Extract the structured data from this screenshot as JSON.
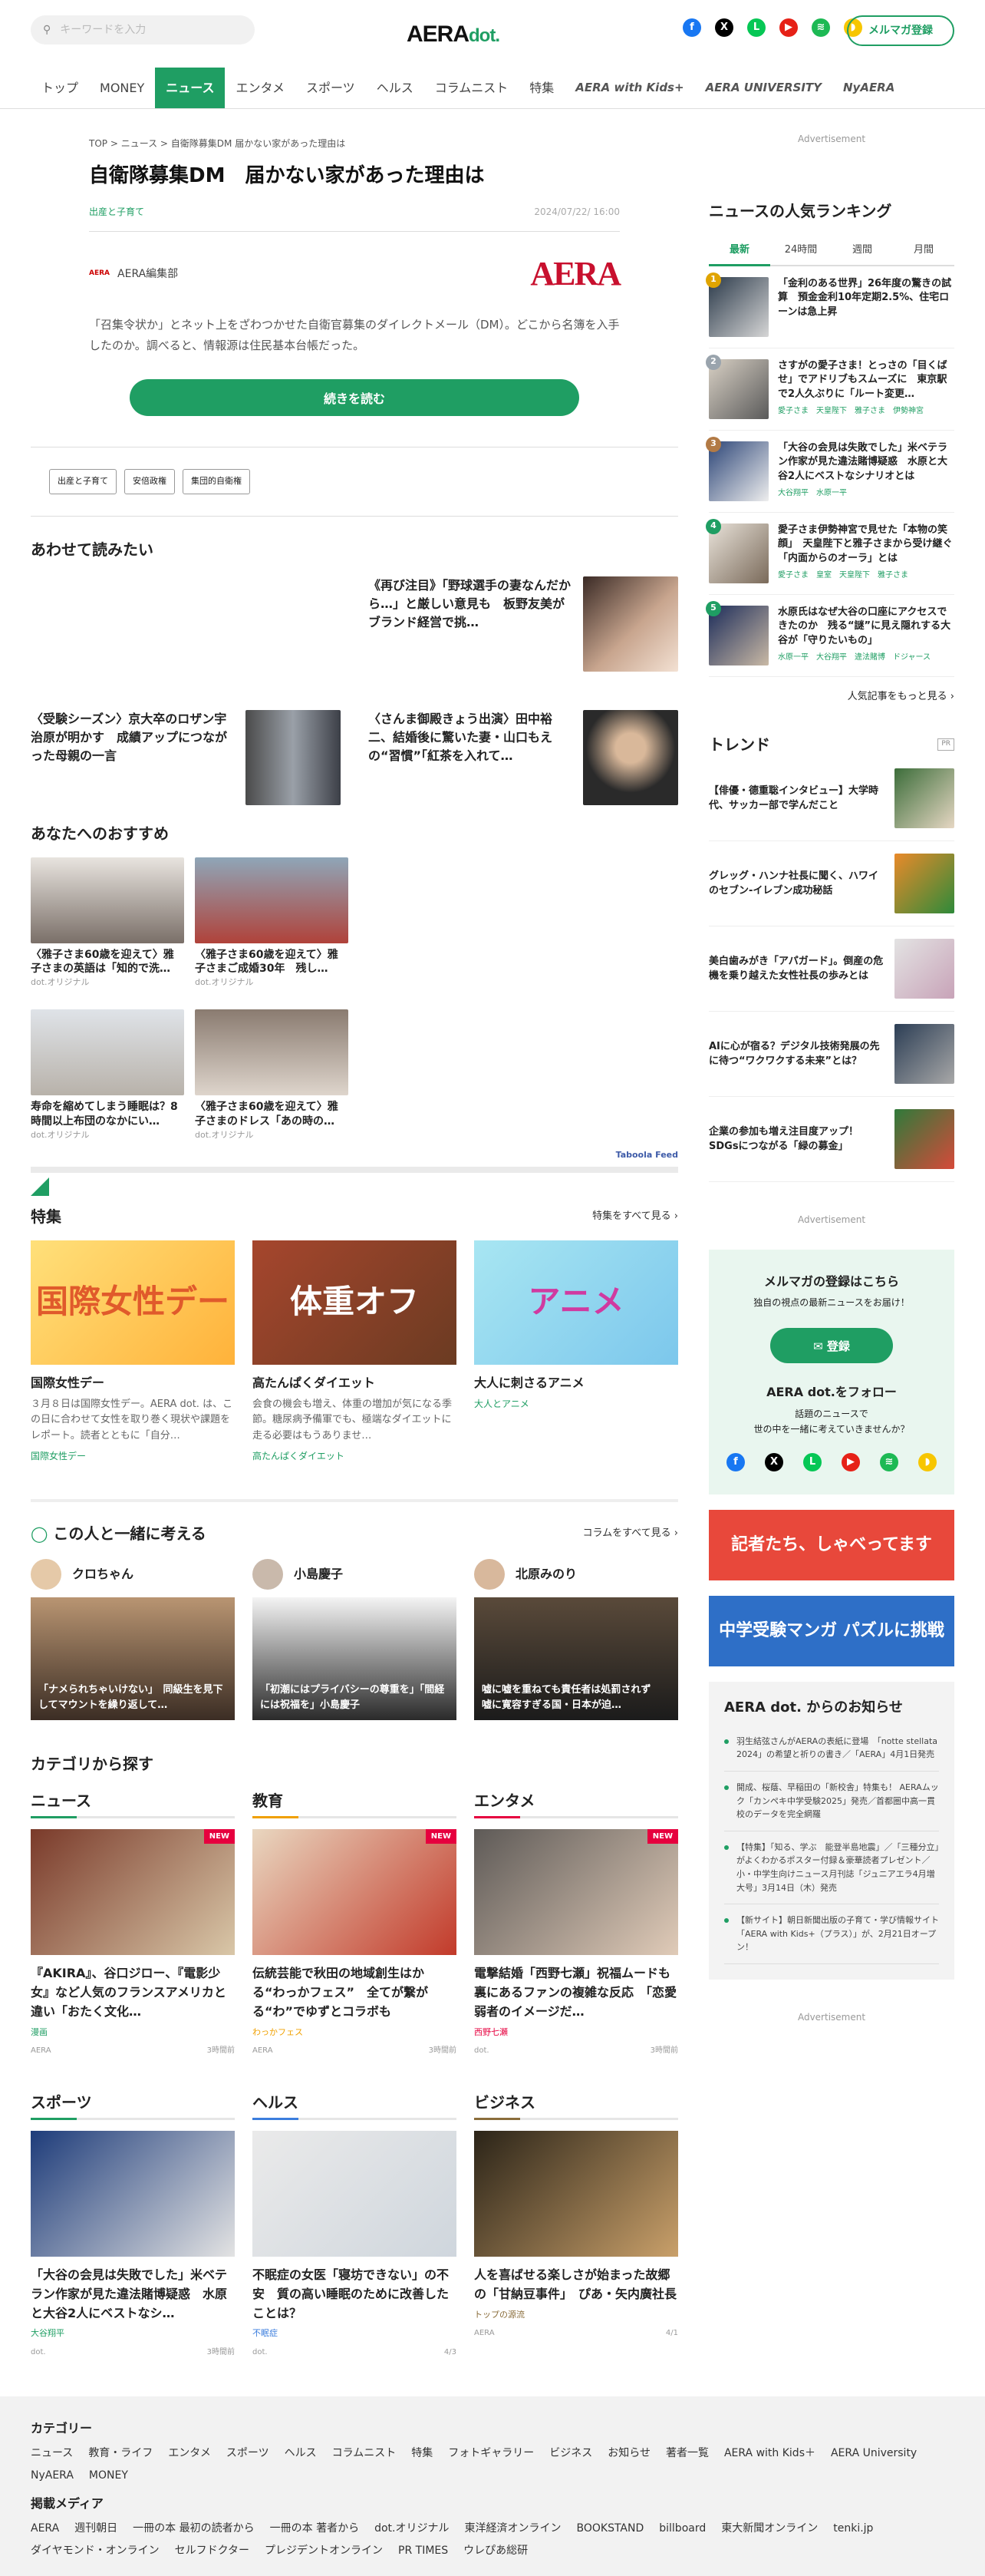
{
  "header": {
    "search_placeholder": "キーワードを入力",
    "logo_main": "AERA",
    "logo_sub": "dot.",
    "mail_button": "メルマガ登録",
    "social": [
      {
        "name": "facebook-icon",
        "glyph": "f",
        "color": "#1877f2"
      },
      {
        "name": "x-icon",
        "glyph": "X",
        "color": "#000000"
      },
      {
        "name": "line-icon",
        "glyph": "L",
        "color": "#06c755"
      },
      {
        "name": "youtube-icon",
        "glyph": "▶",
        "color": "#e62117"
      },
      {
        "name": "spotify-icon",
        "glyph": "≋",
        "color": "#1db954"
      },
      {
        "name": "rss-icon",
        "glyph": "◗",
        "color": "#f7c600"
      }
    ]
  },
  "nav": [
    "トップ",
    "MONEY",
    "ニュース",
    "エンタメ",
    "スポーツ",
    "ヘルス",
    "コラムニスト",
    "特集",
    "AERA with Kids+",
    "AERA UNIVERSITY",
    "NyAERA"
  ],
  "breadcrumb": "TOP > ニュース > 自衛隊募集DM 届かない家があった理由は",
  "article": {
    "title": "自衛隊募集DM　届かない家があった理由は",
    "category": "出産と子育て",
    "date": "2024/07/22/ 16:00",
    "author": "AERA編集部",
    "author_mini": "AERA",
    "brand_logo": "AERA",
    "lead": "「召集令状か」とネット上をざわつかせた自衛官募集のダイレクトメール（DM）。どこから名簿を入手したのか。調べると、情報源は住民基本台帳だった。",
    "read_more": "続きを読む",
    "tags": [
      "出産と子育て",
      "安倍政権",
      "集団的自衛権"
    ]
  },
  "related": {
    "heading": "あわせて読みたい",
    "items": [
      {
        "title": "《再び注目》「野球選手の妻なんだから…」と厳しい意見も　板野友美がブランド経営で挑…"
      },
      {
        "title": "〈受験シーズン〉京大卒のロザン宇治原が明かす　成績アップにつながった母親の一言"
      },
      {
        "title": "〈さんま御殿きょう出演〉田中裕二、結婚後に驚いた妻・山口もえの“習慣”「紅茶を入れて…"
      }
    ]
  },
  "recommend": {
    "heading": "あなたへのおすすめ",
    "items": [
      {
        "title": "〈雅子さま60歳を迎えて〉雅子さまの英語は「知的で洗…",
        "src": "dot.オリジナル"
      },
      {
        "title": "〈雅子さま60歳を迎えて〉雅子さまご成婚30年　残し…",
        "src": "dot.オリジナル"
      },
      {
        "title": "寿命を縮めてしまう睡眠は？8時間以上布団のなかにい…",
        "src": "dot.オリジナル"
      },
      {
        "title": "〈雅子さま60歳を迎えて〉雅子さまのドレス「あの時の…",
        "src": "dot.オリジナル"
      }
    ],
    "taboola": "Taboola Feed"
  },
  "features": {
    "heading": "特集",
    "all": "特集をすべて見る",
    "items": [
      {
        "img": "国際女性デー",
        "title": "国際女性デー",
        "desc": "３月８日は国際女性デー。AERA dot. は、この日に合わせて女性を取り巻く現状や課題をレポート。読者とともに「自分…",
        "tag": "国際女性デー"
      },
      {
        "img": "体重オフ",
        "title": "高たんぱくダイエット",
        "desc": "会食の機会も増え、体重の増加が気になる季節。糖尿病予備軍でも、極端なダイエットに走る必要はもうありませ…",
        "tag": "高たんぱくダイエット"
      },
      {
        "img": "アニメ",
        "title": "大人に刺さるアニメ",
        "desc": "",
        "tag": "大人とアニメ"
      }
    ]
  },
  "people": {
    "heading": "この人と一緒に考える",
    "all": "コラムをすべて見る",
    "items": [
      {
        "name": "クロちゃん",
        "caption": "「ナメられちゃいけない」　同級生を見下してマウントを繰り返して…"
      },
      {
        "name": "小島慶子",
        "caption": "「初潮にはプライバシーの尊重を」「間経には祝福を」小島慶子"
      },
      {
        "name": "北原みのり",
        "caption": "嘘に嘘を重ねても責任者は処罰されず　嘘に寛容すぎる国・日本が迫…"
      }
    ]
  },
  "categories": {
    "heading": "カテゴリから探す",
    "groups": [
      {
        "name": "ニュース",
        "accent": "#1f9e63",
        "title": "『AKIRA』、谷口ジロー、『電影少女』など人気のフランスアメリカと違い「おたく文化…",
        "tag": "漫画",
        "src": "AERA",
        "time": "3時間前"
      },
      {
        "name": "教育",
        "accent": "#f0a000",
        "title": "伝統芸能で秋田の地域創生はかる“わっかフェス”　全てが繋がる“わ”でゆずとコラボも",
        "tag": "わっかフェス",
        "src": "AERA",
        "time": "3時間前"
      },
      {
        "name": "エンタメ",
        "accent": "#e6003e",
        "title": "電撃結婚「西野七瀬」祝福ムードも裏にあるファンの複雑な反応　「恋愛弱者のイメージだ…",
        "tag": "西野七瀬",
        "src": "dot.",
        "time": "3時間前"
      },
      {
        "name": "スポーツ",
        "accent": "#1f9e63",
        "title": "「大谷の会見は失敗でした」米ベテラン作家が見た違法賭博疑惑　水原と大谷2人にベストなシ…",
        "tag": "大谷翔平",
        "src": "dot.",
        "time": "3時間前"
      },
      {
        "name": "ヘルス",
        "accent": "#3b7ddd",
        "title": "不眠症の女医「寝坊できない」の不安　質の高い睡眠のために改善したことは？",
        "tag": "不眠症",
        "src": "dot.",
        "time": "4/3"
      },
      {
        "name": "ビジネス",
        "accent": "#8a6d3b",
        "title": "人を喜ばせる楽しさが始まった故郷の「甘納豆事件」　ぴあ・矢内廣社長",
        "tag": "トップの源流",
        "src": "AERA",
        "time": "4/1"
      }
    ]
  },
  "ad_label": "Advertisement",
  "ranking": {
    "heading": "ニュースの人気ランキング",
    "tabs": [
      "最新",
      "24時間",
      "週間",
      "月間"
    ],
    "items": [
      {
        "n": "1",
        "title": "「金利のある世界」26年度の驚きの試算　預金金利10年定期2.5%、住宅ローンは急上昇",
        "kw": ""
      },
      {
        "n": "2",
        "title": "さすがの愛子さま！とっさの「目くばせ」でアドリブもスムーズに　東京駅で2人久ぶりに「ルート変更…",
        "kw": "愛子さま　天皇陛下　雅子さま　伊勢神宮"
      },
      {
        "n": "3",
        "title": "「大谷の会見は失敗でした」米ベテラン作家が見た違法賭博疑惑　水原と大谷2人にベストなシナリオとは",
        "kw": "大谷翔平　水原一平"
      },
      {
        "n": "4",
        "title": "愛子さま伊勢神宮で見せた「本物の笑顔」　天皇陛下と雅子さまから受け継ぐ「内面からのオーラ」とは",
        "kw": "愛子さま　皇室　天皇陛下　雅子さま"
      },
      {
        "n": "5",
        "title": "水原氏はなぜ大谷の口座にアクセスできたのか　残る“謎”に見え隠れする大谷が「守りたいもの」",
        "kw": "水原一平　大谷翔平　違法賭博　ドジャース"
      }
    ],
    "more": "人気記事をもっと見る"
  },
  "trend": {
    "heading": "トレンド",
    "pr": "PR",
    "items": [
      {
        "title": "【俳優・德重聡インタビュー】大学時代、サッカー部で学んだこと"
      },
      {
        "title": "グレッグ・ハンナ社長に聞く、ハワイのセブン‐イレブン成功秘話"
      },
      {
        "title": "美白歯みがき「アパガード」。倒産の危機を乗り越えた女性社長の歩みとは"
      },
      {
        "title": "AIに心が宿る？デジタル技術発展の先に待つ“ワクワクする未来”とは？"
      },
      {
        "title": "企業の参加も増え注目度アップ！SDGsにつながる「緑の募金」"
      }
    ]
  },
  "mailmag": {
    "title": "メルマガの登録はこちら",
    "sub": "独自の視点の最新ニュースをお届け！",
    "button": "登録",
    "follow": "AERA dot.をフォロー",
    "follow_sub1": "話題のニュースで",
    "follow_sub2": "世の中を一緒に考えていきませんか？"
  },
  "banners": [
    {
      "text": "記者たち、しゃべってます",
      "color": "#e8483b"
    },
    {
      "text": "中学受験マンガ パズルに挑戦",
      "color": "#2e6fc7"
    }
  ],
  "notice": {
    "title": "AERA dot. からのお知らせ",
    "items": [
      "羽生結弦さんがAERAの表紙に登場　「notte stellata 2024」の希望と祈りの書き／「AERA」4月1日発売",
      "開成、桜蔭、早稲田の「新校舎」特集も！ AERAムック「カンペキ中学受験2025」発売／首都圏中高一貫校のデータを完全網羅",
      "【特集】「知る、学ぶ　能登半島地震」／「三種分立」がよくわかるポスター付録＆豪華読者プレゼント／小・中学生向けニュース月刊誌「ジュニアエラ4月増大号」3月14日（木）発売",
      "【新サイト】朝日新聞出版の子育て・学び情報サイト「AERA with Kids+（プラス）」が、2月21日オープン！"
    ]
  },
  "footer": {
    "cat_heading": "カテゴリー",
    "cats": [
      "ニュース",
      "教育・ライフ",
      "エンタメ",
      "スポーツ",
      "ヘルス",
      "コラムニスト",
      "特集",
      "フォトギャラリー",
      "ビジネス",
      "お知らせ",
      "著者一覧",
      "AERA with Kids＋",
      "AERA University",
      "NyAERA",
      "MONEY"
    ],
    "media_heading": "掲載メディア",
    "media": [
      "AERA",
      "週刊朝日",
      "一冊の本 最初の読者から",
      "一冊の本 著者から",
      "dot.オリジナル",
      "東洋経済オンライン",
      "BOOKSTAND",
      "billboard",
      "東大新聞オンライン",
      "tenki.jp",
      "ダイヤモンド・オンライン",
      "セルフドクター",
      "プレジデントオンライン",
      "PR TIMES",
      "ウレぴあ総研"
    ]
  }
}
